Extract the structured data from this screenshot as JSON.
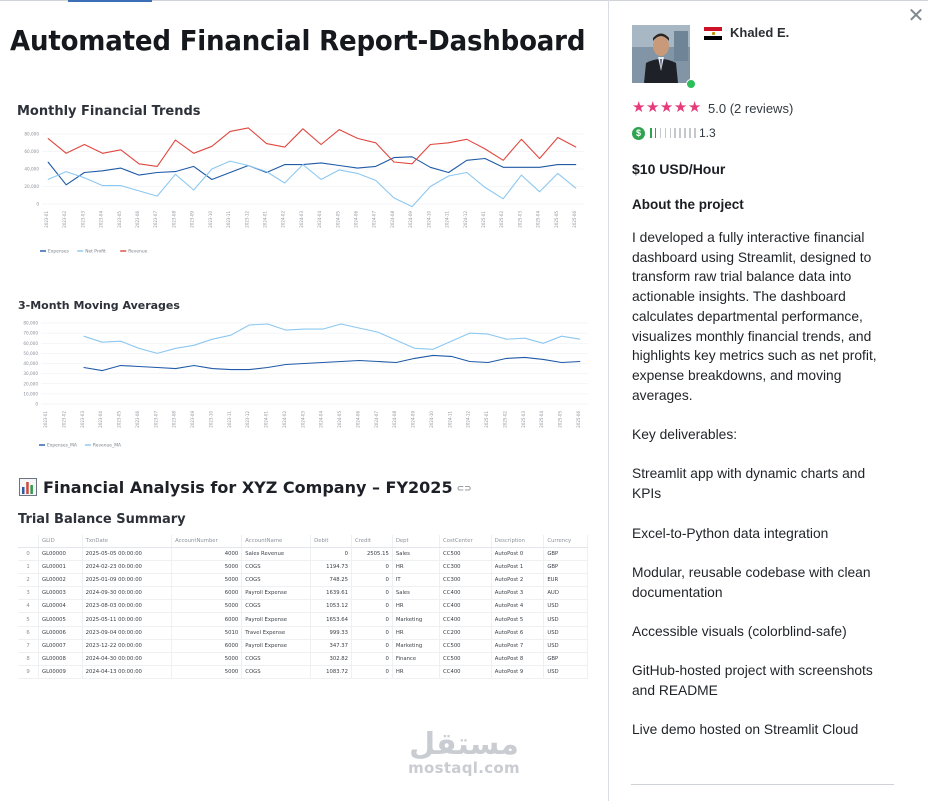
{
  "project": {
    "title": "Automated Financial Report-Dashboard"
  },
  "charts": {
    "monthly_title": "Monthly Financial Trends",
    "moving_title": "3-Month Moving Averages"
  },
  "chart_data": [
    {
      "type": "line",
      "title": "Monthly Financial Trends",
      "x": [
        "2023-01",
        "2023-02",
        "2023-03",
        "2023-04",
        "2023-05",
        "2023-06",
        "2023-07",
        "2023-08",
        "2023-09",
        "2023-10",
        "2023-11",
        "2023-12",
        "2024-01",
        "2024-02",
        "2024-03",
        "2024-04",
        "2024-05",
        "2024-06",
        "2024-07",
        "2024-08",
        "2024-09",
        "2024-10",
        "2024-11",
        "2024-12",
        "2025-01",
        "2025-02",
        "2025-03",
        "2025-04",
        "2025-05",
        "2025-06"
      ],
      "yticks": [
        "80,000",
        "60,000",
        "40,000",
        "20,000",
        "0"
      ],
      "ylim": [
        0,
        80000
      ],
      "series": [
        {
          "name": "Expenses",
          "color": "#1f5aa6",
          "values": [
            48000,
            22000,
            36000,
            38000,
            41000,
            33000,
            36000,
            37000,
            43000,
            28000,
            36000,
            44000,
            36000,
            45000,
            45000,
            47000,
            44000,
            41000,
            43000,
            53000,
            54000,
            42000,
            36000,
            50000,
            52000,
            42000,
            42000,
            42000,
            45000,
            45000
          ]
        },
        {
          "name": "Net Profit",
          "color": "#8cc8f0",
          "values": [
            28000,
            37000,
            30000,
            21000,
            21000,
            15000,
            9000,
            34000,
            16000,
            40000,
            49000,
            44000,
            37000,
            24000,
            45000,
            28000,
            39000,
            35000,
            27000,
            7000,
            -3000,
            20000,
            32000,
            36000,
            19000,
            6000,
            33000,
            14000,
            35000,
            18000
          ]
        },
        {
          "name": "Revenue",
          "color": "#e0473f",
          "values": [
            75000,
            58000,
            68000,
            58000,
            62000,
            46000,
            43000,
            73000,
            58000,
            66000,
            83000,
            87000,
            69000,
            65000,
            86000,
            68000,
            85000,
            75000,
            70000,
            48000,
            46000,
            68000,
            70000,
            74000,
            63000,
            50000,
            74000,
            52000,
            76000,
            65000
          ]
        }
      ]
    },
    {
      "type": "line",
      "title": "3-Month Moving Averages",
      "x": [
        "2023-01",
        "2023-02",
        "2023-03",
        "2023-04",
        "2023-05",
        "2023-06",
        "2023-07",
        "2023-08",
        "2023-09",
        "2023-10",
        "2023-11",
        "2023-12",
        "2024-01",
        "2024-02",
        "2024-03",
        "2024-04",
        "2024-05",
        "2024-06",
        "2024-07",
        "2024-08",
        "2024-09",
        "2024-10",
        "2024-11",
        "2024-12",
        "2025-01",
        "2025-02",
        "2025-03",
        "2025-04",
        "2025-05",
        "2025-06"
      ],
      "yticks": [
        "80,000",
        "70,000",
        "60,000",
        "50,000",
        "40,000",
        "30,000",
        "20,000",
        "10,000",
        "0"
      ],
      "ylim": [
        0,
        80000
      ],
      "series": [
        {
          "name": "Expenses_MA",
          "color": "#1f5aa6",
          "values": [
            null,
            null,
            36000,
            33000,
            38000,
            37000,
            36000,
            35000,
            38000,
            35000,
            34000,
            34000,
            36000,
            39000,
            40000,
            41000,
            42000,
            43000,
            42000,
            41000,
            45000,
            48000,
            47000,
            42000,
            41000,
            45000,
            46000,
            44000,
            41000,
            42000
          ]
        },
        {
          "name": "Revenue_MA",
          "color": "#8cc8f0",
          "values": [
            null,
            null,
            67000,
            61000,
            62000,
            55000,
            50000,
            55000,
            58000,
            64000,
            68000,
            78000,
            79000,
            73000,
            74000,
            74000,
            79000,
            75000,
            71000,
            63000,
            55000,
            54000,
            62000,
            70000,
            69000,
            64000,
            65000,
            60000,
            67000,
            64000
          ]
        }
      ]
    },
    {
      "type": "table",
      "title": "Trial Balance Summary",
      "columns": [
        "GLID",
        "TxnDate",
        "AccountNumber",
        "AccountName",
        "Debit",
        "Credit",
        "Dept",
        "CostCenter",
        "Description",
        "Currency"
      ],
      "rows": [
        [
          "GL00000",
          "2025-05-05 00:00:00",
          "4000",
          "Sales Revenue",
          "0",
          "2505.15",
          "Sales",
          "CC500",
          "AutoPost 0",
          "GBP"
        ],
        [
          "GL00001",
          "2024-02-23 00:00:00",
          "5000",
          "COGS",
          "1194.73",
          "0",
          "HR",
          "CC300",
          "AutoPost 1",
          "GBP"
        ],
        [
          "GL00002",
          "2025-01-09 00:00:00",
          "5000",
          "COGS",
          "748.25",
          "0",
          "IT",
          "CC300",
          "AutoPost 2",
          "EUR"
        ],
        [
          "GL00003",
          "2024-09-30 00:00:00",
          "6000",
          "Payroll Expense",
          "1639.61",
          "0",
          "Sales",
          "CC400",
          "AutoPost 3",
          "AUD"
        ],
        [
          "GL00004",
          "2023-08-03 00:00:00",
          "5000",
          "COGS",
          "1053.12",
          "0",
          "HR",
          "CC400",
          "AutoPost 4",
          "USD"
        ],
        [
          "GL00005",
          "2025-05-11 00:00:00",
          "6000",
          "Payroll Expense",
          "1653.64",
          "0",
          "Marketing",
          "CC400",
          "AutoPost 5",
          "USD"
        ],
        [
          "GL00006",
          "2023-09-04 00:00:00",
          "5010",
          "Travel Expense",
          "999.33",
          "0",
          "HR",
          "CC200",
          "AutoPost 6",
          "USD"
        ],
        [
          "GL00007",
          "2023-12-22 00:00:00",
          "6000",
          "Payroll Expense",
          "347.37",
          "0",
          "Marketing",
          "CC500",
          "AutoPost 7",
          "USD"
        ],
        [
          "GL00008",
          "2024-04-30 00:00:00",
          "5000",
          "COGS",
          "302.82",
          "0",
          "Finance",
          "CC500",
          "AutoPost 8",
          "GBP"
        ],
        [
          "GL00009",
          "2024-04-13 00:00:00",
          "5000",
          "COGS",
          "1083.72",
          "0",
          "HR",
          "CC400",
          "AutoPost 9",
          "USD"
        ]
      ]
    }
  ],
  "analysis": {
    "title": "Financial Analysis for XYZ Company – FY2025",
    "table_title": "Trial Balance Summary"
  },
  "watermark": {
    "arabic": "مستقل",
    "latin": "mostaql.com"
  },
  "freelancer": {
    "name": "Khaled E.",
    "rating": "5.0",
    "reviews": "(2 reviews)",
    "score": "1.3",
    "price": "$10 USD/Hour"
  },
  "about": {
    "heading": "About the project",
    "paragraphs": [
      "I developed a fully interactive financial dashboard using Streamlit, designed to transform raw trial balance data into actionable insights. The dashboard calculates departmental performance, visualizes monthly financial trends, and highlights key metrics such as net profit, expense breakdowns, and moving averages.",
      "Key deliverables:",
      "Streamlit app with dynamic charts and KPIs",
      "Excel-to-Python data integration",
      "Modular, reusable codebase with clean documentation",
      "Accessible visuals (colorblind-safe)",
      "GitHub-hosted project with screenshots and README",
      "Live demo hosted on Streamlit Cloud"
    ]
  }
}
